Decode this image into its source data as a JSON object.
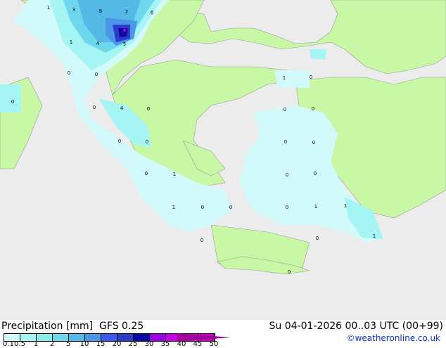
{
  "map": {
    "colors": {
      "sea": "#ececec",
      "land": "#c8f7a6",
      "border": "#999999"
    },
    "labels": [
      "1",
      "3",
      "6",
      "2",
      "6",
      "1",
      "4",
      "5",
      "0",
      "0",
      "1",
      "0",
      "0",
      "0",
      "4",
      "0",
      "0",
      "0",
      "0",
      "0",
      "0",
      "0",
      "0",
      "1",
      "0",
      "0",
      "1",
      "0",
      "0",
      "0",
      "1",
      "1",
      "1",
      "0",
      "0",
      "0"
    ]
  },
  "footer": {
    "title": "Precipitation [mm]  GFS 0.25",
    "date": "Su 04-01-2026 00..03 UTC (00+99)",
    "credit": "©weatheronline.co.uk",
    "legend": {
      "ticks": [
        "0.1",
        "0.5",
        "1",
        "2",
        "5",
        "10",
        "15",
        "20",
        "25",
        "30",
        "35",
        "40",
        "45",
        "50"
      ],
      "colors": [
        "#d2fafa",
        "#a5f5f5",
        "#8cebeb",
        "#6ed7ec",
        "#55b9e8",
        "#4b96e6",
        "#3c5ae6",
        "#2d3cc8",
        "#0a0aa0",
        "#9a00e6",
        "#c800e6",
        "#f000f0",
        "#c800c8",
        "#a0009a"
      ]
    }
  }
}
